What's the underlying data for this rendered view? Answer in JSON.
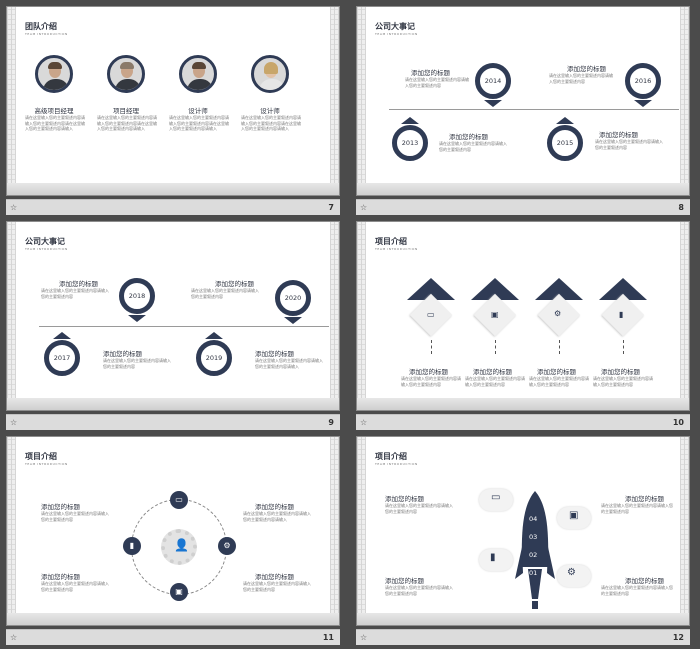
{
  "slides": [
    {
      "number": "7",
      "title": "团队介绍",
      "subtitle": "TEAM INTRODUCTION",
      "members": [
        {
          "role": "高级项目经理",
          "desc": "请在这里输入您的主要叙述内容请输入您的主要叙述内容请在这里输入您的主要叙述内容请输入"
        },
        {
          "role": "项目经理",
          "desc": "请在这里输入您的主要叙述内容请输入您的主要叙述内容请在这里输入您的主要叙述内容请输入"
        },
        {
          "role": "设计师",
          "desc": "请在这里输入您的主要叙述内容请输入您的主要叙述内容请在这里输入您的主要叙述内容请输入"
        },
        {
          "role": "设计师",
          "desc": "请在这里输入您的主要叙述内容请输入您的主要叙述内容请在这里输入您的主要叙述内容请输入"
        }
      ]
    },
    {
      "number": "8",
      "title": "公司大事记",
      "subtitle": "TEAM INTRODUCTION",
      "events": [
        {
          "year": "2014",
          "heading": "添加您的标题",
          "desc": "请在这里输入您的主要叙述内容请输入您的主要叙述内容"
        },
        {
          "year": "2016",
          "heading": "添加您的标题",
          "desc": "请在这里输入您的主要叙述内容请输入您的主要叙述内容"
        },
        {
          "year": "2013",
          "heading": "添加您的标题",
          "desc": "请在这里输入您的主要叙述内容请输入您的主要叙述内容"
        },
        {
          "year": "2015",
          "heading": "添加您的标题",
          "desc": "请在这里输入您的主要叙述内容请输入您的主要叙述内容"
        }
      ]
    },
    {
      "number": "9",
      "title": "公司大事记",
      "subtitle": "TEAM INTRODUCTION",
      "events": [
        {
          "year": "2018",
          "heading": "添加您的标题",
          "desc": "请在这里输入您的主要叙述内容请输入您的主要叙述内容"
        },
        {
          "year": "2020",
          "heading": "添加您的标题",
          "desc": "请在这里输入您的主要叙述内容请输入您的主要叙述内容"
        },
        {
          "year": "2017",
          "heading": "添加您的标题",
          "desc": "请在这里输入您的主要叙述内容请输入您的主要叙述内容"
        },
        {
          "year": "2019",
          "heading": "添加您的标题",
          "desc": "请在这里输入您的主要叙述内容请输入您的主要叙述内容请输入"
        }
      ]
    },
    {
      "number": "10",
      "title": "项目介绍",
      "subtitle": "TEAM INTRODUCTION",
      "items": [
        {
          "heading": "添加您的标题",
          "desc": "请在这里输入您的主要叙述内容请输入您的主要叙述内容"
        },
        {
          "heading": "添加您的标题",
          "desc": "请在这里输入您的主要叙述内容请输入您的主要叙述内容"
        },
        {
          "heading": "添加您的标题",
          "desc": "请在这里输入您的主要叙述内容请输入您的主要叙述内容"
        },
        {
          "heading": "添加您的标题",
          "desc": "请在这里输入您的主要叙述内容请输入您的主要叙述内容"
        }
      ]
    },
    {
      "number": "11",
      "title": "项目介绍",
      "subtitle": "TEAM INTRODUCTION",
      "items": [
        {
          "heading": "添加您的标题",
          "desc": "请在这里输入您的主要叙述内容请输入您的主要叙述内容"
        },
        {
          "heading": "添加您的标题",
          "desc": "请在这里输入您的主要叙述内容请输入您的主要叙述内容请输入"
        },
        {
          "heading": "添加您的标题",
          "desc": "请在这里输入您的主要叙述内容请输入您的主要叙述内容"
        },
        {
          "heading": "添加您的标题",
          "desc": "请在这里输入您的主要叙述内容请输入您的主要叙述内容"
        }
      ]
    },
    {
      "number": "12",
      "title": "项目介绍",
      "subtitle": "TEAM INTRODUCTION",
      "rocket_numbers": [
        "04",
        "03",
        "02",
        "01"
      ],
      "items": [
        {
          "heading": "添加您的标题",
          "desc": "请在这里输入您的主要叙述内容请输入您的主要叙述内容"
        },
        {
          "heading": "添加您的标题",
          "desc": "请在这里输入您的主要叙述内容请输入您的主要叙述内容"
        },
        {
          "heading": "添加您的标题",
          "desc": "请在这里输入您的主要叙述内容请输入您的主要叙述内容"
        },
        {
          "heading": "添加您的标题",
          "desc": "请在这里输入您的主要叙述内容请输入您的主要叙述内容"
        }
      ]
    }
  ],
  "colors": {
    "accent": "#2f3b55",
    "background": "#4b4b4b"
  },
  "icons": [
    "star-icon",
    "chat-icon",
    "briefcase-icon",
    "gears-icon",
    "bar-chart-icon",
    "user-icon",
    "bag-icon"
  ]
}
